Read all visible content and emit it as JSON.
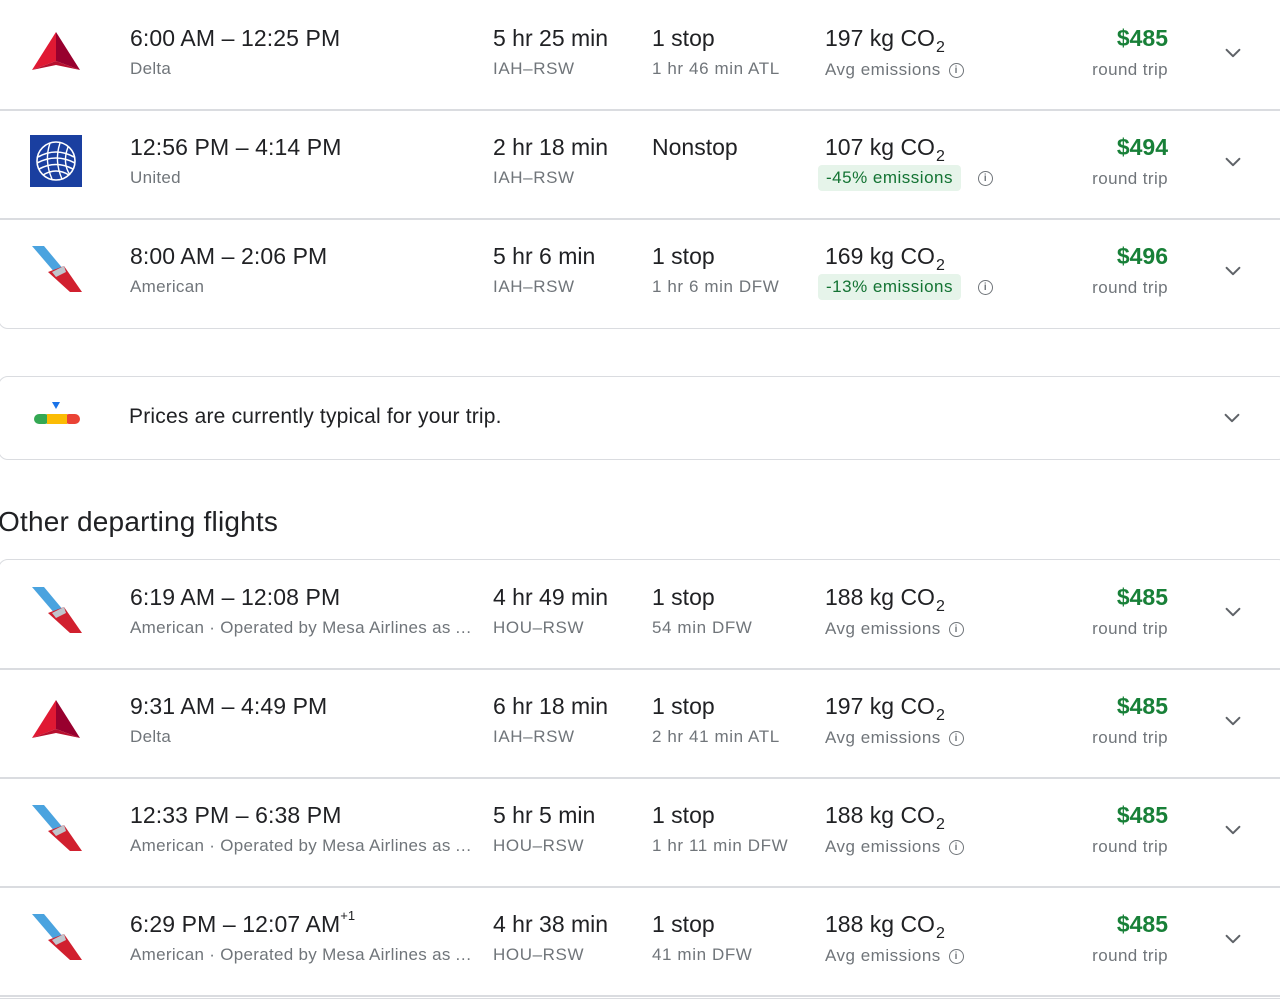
{
  "colors": {
    "price_green": "#188038",
    "badge_bg": "#e6f4ea",
    "badge_text": "#137333",
    "delta_red": "#c8102e",
    "united_blue": "#1a3fa0",
    "american_blue": "#4aa3df"
  },
  "top_flights": [
    {
      "logo": "delta-logo",
      "times": "6:00 AM – 12:25 PM",
      "day_offset": "",
      "airline": "Delta",
      "duration": "5 hr 25 min",
      "route": "IAH–RSW",
      "stops": "1 stop",
      "layover": "1 hr 46 min ATL",
      "co2_value": "197 kg CO",
      "co2_sub": "2",
      "emissions": "Avg emissions",
      "badge": false,
      "price": "$485",
      "trip": "round trip"
    },
    {
      "logo": "united-logo",
      "times": "12:56 PM – 4:14 PM",
      "day_offset": "",
      "airline": "United",
      "duration": "2 hr 18 min",
      "route": "IAH–RSW",
      "stops": "Nonstop",
      "layover": "",
      "co2_value": "107 kg CO",
      "co2_sub": "2",
      "emissions": "-45% emissions",
      "badge": true,
      "price": "$494",
      "trip": "round trip"
    },
    {
      "logo": "american-logo",
      "times": "8:00 AM – 2:06 PM",
      "day_offset": "",
      "airline": "American",
      "duration": "5 hr 6 min",
      "route": "IAH–RSW",
      "stops": "1 stop",
      "layover": "1 hr 6 min DFW",
      "co2_value": "169 kg CO",
      "co2_sub": "2",
      "emissions": "-13% emissions",
      "badge": true,
      "price": "$496",
      "trip": "round trip"
    }
  ],
  "price_insight": {
    "text": "Prices are currently typical for your trip.",
    "icon": "price-level-icon"
  },
  "other_section": {
    "title": "Other departing flights"
  },
  "other_flights": [
    {
      "logo": "american-logo",
      "times": "6:19 AM – 12:08 PM",
      "day_offset": "",
      "airline": "American · Operated by Mesa Airlines as American Eagle",
      "duration": "4 hr 49 min",
      "route": "HOU–RSW",
      "stops": "1 stop",
      "layover": "54 min DFW",
      "co2_value": "188 kg CO",
      "co2_sub": "2",
      "emissions": "Avg emissions",
      "badge": false,
      "price": "$485",
      "trip": "round trip"
    },
    {
      "logo": "delta-logo",
      "times": "9:31 AM – 4:49 PM",
      "day_offset": "",
      "airline": "Delta",
      "duration": "6 hr 18 min",
      "route": "IAH–RSW",
      "stops": "1 stop",
      "layover": "2 hr 41 min ATL",
      "co2_value": "197 kg CO",
      "co2_sub": "2",
      "emissions": "Avg emissions",
      "badge": false,
      "price": "$485",
      "trip": "round trip"
    },
    {
      "logo": "american-logo",
      "times": "12:33 PM – 6:38 PM",
      "day_offset": "",
      "airline": "American · Operated by Mesa Airlines as American Eagle",
      "duration": "5 hr 5 min",
      "route": "HOU–RSW",
      "stops": "1 stop",
      "layover": "1 hr 11 min DFW",
      "co2_value": "188 kg CO",
      "co2_sub": "2",
      "emissions": "Avg emissions",
      "badge": false,
      "price": "$485",
      "trip": "round trip"
    },
    {
      "logo": "american-logo",
      "times": "6:29 PM – 12:07 AM",
      "day_offset": "+1",
      "airline": "American · Operated by Mesa Airlines as American Eagle",
      "duration": "4 hr 38 min",
      "route": "HOU–RSW",
      "stops": "1 stop",
      "layover": "41 min DFW",
      "co2_value": "188 kg CO",
      "co2_sub": "2",
      "emissions": "Avg emissions",
      "badge": false,
      "price": "$485",
      "trip": "round trip"
    }
  ]
}
